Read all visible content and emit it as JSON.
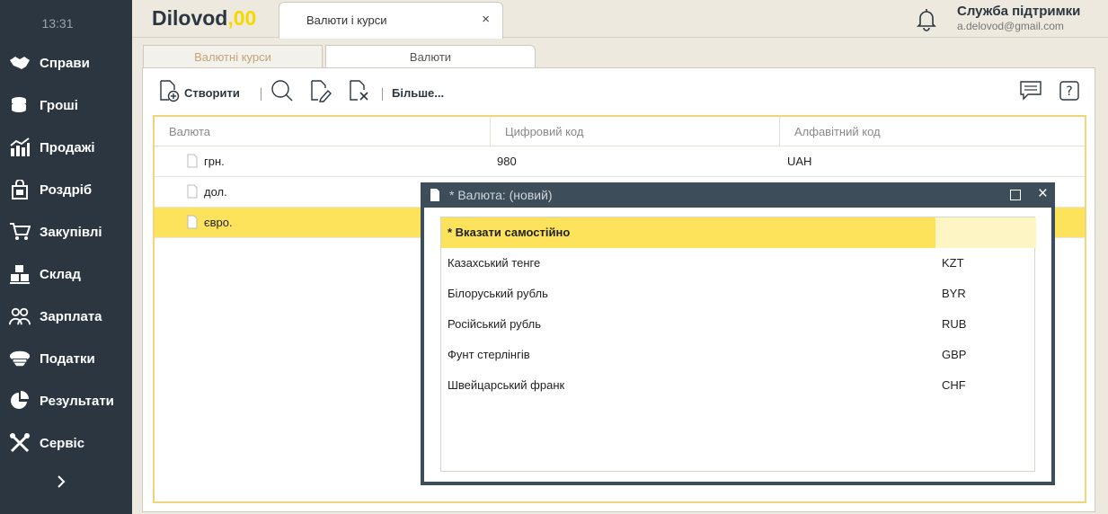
{
  "sidebar": {
    "time": "13:31",
    "items": [
      {
        "label": "Справи",
        "icon": "handshake-icon"
      },
      {
        "label": "Гроші",
        "icon": "coins-icon"
      },
      {
        "label": "Продажі",
        "icon": "sales-chart-icon"
      },
      {
        "label": "Роздріб",
        "icon": "shopping-bag-icon"
      },
      {
        "label": "Закупівлі",
        "icon": "cart-icon"
      },
      {
        "label": "Склад",
        "icon": "boxes-icon"
      },
      {
        "label": "Зарплата",
        "icon": "people-icon"
      },
      {
        "label": "Податки",
        "icon": "officer-cap-icon"
      },
      {
        "label": "Результати",
        "icon": "pie-chart-icon"
      },
      {
        "label": "Сервіс",
        "icon": "tools-icon"
      }
    ],
    "expand_icon": "chevron-right-icon"
  },
  "header": {
    "logo_text": "Dilovod",
    "logo_suffix": ",00",
    "doc_tab_title": "Валюти і курси",
    "doc_tab_close": "×",
    "support_title": "Служба підтримки",
    "support_email": "a.delovod@gmail.com"
  },
  "tabs": [
    {
      "label": "Валютні курси",
      "active": false
    },
    {
      "label": "Валюти",
      "active": true
    }
  ],
  "toolbar": {
    "create_label": "Створити",
    "more_label": "Більше..."
  },
  "grid": {
    "columns": [
      "Валюта",
      "Цифровий код",
      "Алфавітний код"
    ],
    "rows": [
      {
        "name": "грн.",
        "num": "980",
        "alpha": "UAH",
        "selected": false
      },
      {
        "name": "дол.",
        "num": "",
        "alpha": "",
        "selected": false
      },
      {
        "name": "євро.",
        "num": "",
        "alpha": "",
        "selected": true
      }
    ]
  },
  "modal": {
    "title": "* Валюта: (новий)",
    "close": "×",
    "items": [
      {
        "name": "* Вказати самостійно",
        "code": "",
        "selected": true
      },
      {
        "name": "Казахський тенге",
        "code": "KZT",
        "selected": false
      },
      {
        "name": "Білоруський рубль",
        "code": "BYR",
        "selected": false
      },
      {
        "name": "Російський рубль",
        "code": "RUB",
        "selected": false
      },
      {
        "name": "Фунт стерлінгів",
        "code": "GBP",
        "selected": false
      },
      {
        "name": "Швейцарський франк",
        "code": "CHF",
        "selected": false
      }
    ]
  },
  "colors": {
    "sidebar_bg": "#2b3640",
    "accent_yellow": "#fde35c",
    "modal_header": "#3e4d5a"
  }
}
